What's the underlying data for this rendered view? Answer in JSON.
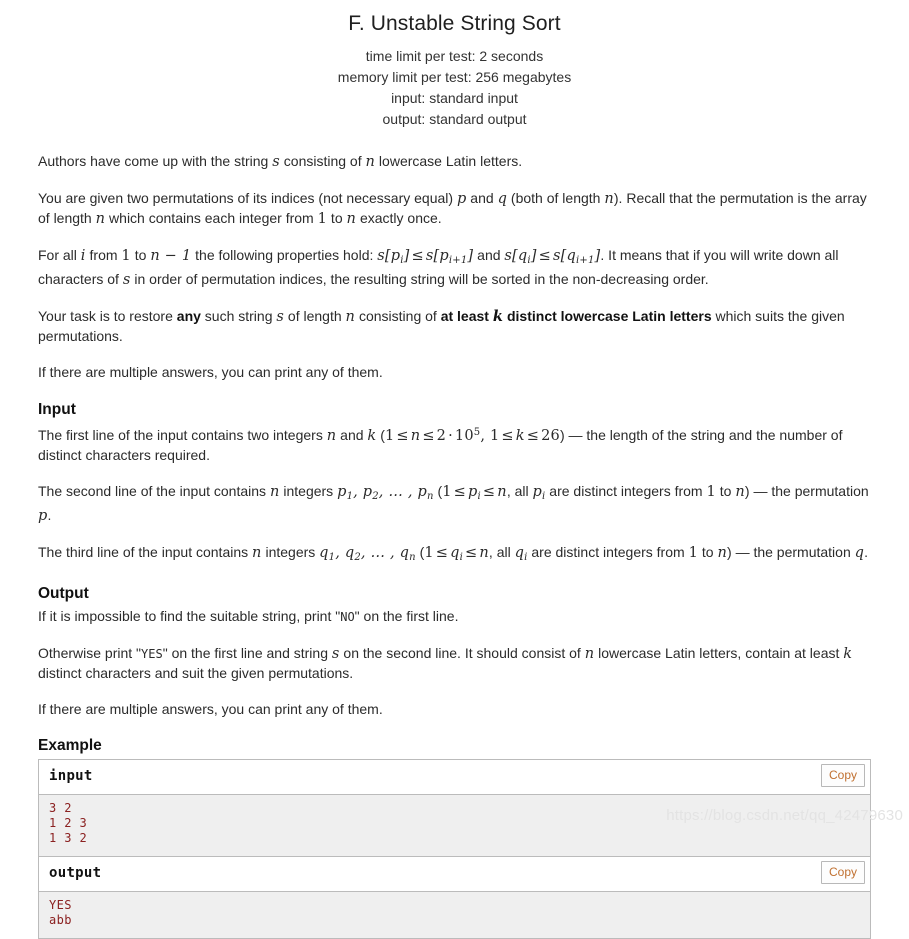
{
  "header": {
    "title": "F. Unstable String Sort",
    "time_limit": "time limit per test: 2 seconds",
    "memory_limit": "memory limit per test: 256 megabytes",
    "input_mode": "input: standard input",
    "output_mode": "output: standard output"
  },
  "statement": {
    "p1_a": "Authors have come up with the string ",
    "p1_s": "s",
    "p1_b": " consisting of ",
    "p1_n": "n",
    "p1_c": " lowercase Latin letters.",
    "p2_a": "You are given two permutations of its indices (not necessary equal) ",
    "p2_p": "p",
    "p2_b": " and ",
    "p2_q": "q",
    "p2_c": " (both of length ",
    "p2_n": "n",
    "p2_d": "). Recall that the permutation is the array of length ",
    "p2_n2": "n",
    "p2_e": " which contains each integer from ",
    "p2_one": "1",
    "p2_f": " to ",
    "p2_n3": "n",
    "p2_g": " exactly once.",
    "p3_a": "For all ",
    "p3_i": "i",
    "p3_b": " from ",
    "p3_one": "1",
    "p3_c": " to ",
    "p3_nm1": "n − 1",
    "p3_d": " the following properties hold: ",
    "p3_e": " and ",
    "p3_f": ". It means that if you will write down all characters of ",
    "p3_s": "s",
    "p3_g": " in order of permutation indices, the resulting string will be sorted in the non-decreasing order.",
    "p4_a": "Your task is to restore ",
    "p4_any": "any",
    "p4_b": " such string ",
    "p4_s": "s",
    "p4_c": " of length ",
    "p4_n": "n",
    "p4_d": " consisting of ",
    "p4_bold1": "at least ",
    "p4_k": "k",
    "p4_bold2": " distinct lowercase Latin letters",
    "p4_e": " which suits the given permutations.",
    "p5": "If there are multiple answers, you can print any of them."
  },
  "input_section": {
    "title": "Input",
    "l1_a": "The first line of the input contains two integers ",
    "l1_n": "n",
    "l1_b": " and ",
    "l1_k": "k",
    "l1_c": " (",
    "l1_constraint1": "1 ≤ n ≤ 2 · 10",
    "l1_exp": "5",
    "l1_constraint2": ", 1 ≤ k ≤ 26",
    "l1_d": ") — the length of the string and the number of distinct characters required.",
    "l2_a": "The second line of the input contains ",
    "l2_n": "n",
    "l2_b": " integers ",
    "l2_list": "p1, p2, … , pn",
    "l2_c": " (",
    "l2_constraint": "1 ≤ pi ≤ n",
    "l2_d": ", all ",
    "l2_pi": "pi",
    "l2_e": " are distinct integers from ",
    "l2_one": "1",
    "l2_f": " to ",
    "l2_n2": "n",
    "l2_g": ") — the permutation ",
    "l2_p": "p",
    "l2_h": ".",
    "l3_a": "The third line of the input contains ",
    "l3_n": "n",
    "l3_b": " integers ",
    "l3_list": "q1, q2, … , qn",
    "l3_c": " (",
    "l3_constraint": "1 ≤ qi ≤ n",
    "l3_d": ", all ",
    "l3_qi": "qi",
    "l3_e": " are distinct integers from ",
    "l3_one": "1",
    "l3_f": " to ",
    "l3_n2": "n",
    "l3_g": ") — the permutation ",
    "l3_q": "q",
    "l3_h": "."
  },
  "output_section": {
    "title": "Output",
    "o1_a": "If it is impossible to find the suitable string, print \"",
    "o1_no": "NO",
    "o1_b": "\" on the first line.",
    "o2_a": "Otherwise print \"",
    "o2_yes": "YES",
    "o2_b": "\" on the first line and string ",
    "o2_s": "s",
    "o2_c": " on the second line. It should consist of ",
    "o2_n": "n",
    "o2_d": " lowercase Latin letters, contain at least ",
    "o2_k": "k",
    "o2_e": " distinct characters and suit the given permutations.",
    "o3": "If there are multiple answers, you can print any of them."
  },
  "example": {
    "title": "Example",
    "input_label": "input",
    "output_label": "output",
    "copy_label": "Copy",
    "input_text": "3 2\n1 2 3\n1 3 2",
    "output_text": "YES\nabb"
  },
  "watermark": "https://blog.csdn.net/qq_42479630",
  "colors": {
    "sample_text": "#8b2121",
    "sample_bg": "#efefef",
    "copy_text": "#c07030",
    "border": "#bbbbbb"
  }
}
